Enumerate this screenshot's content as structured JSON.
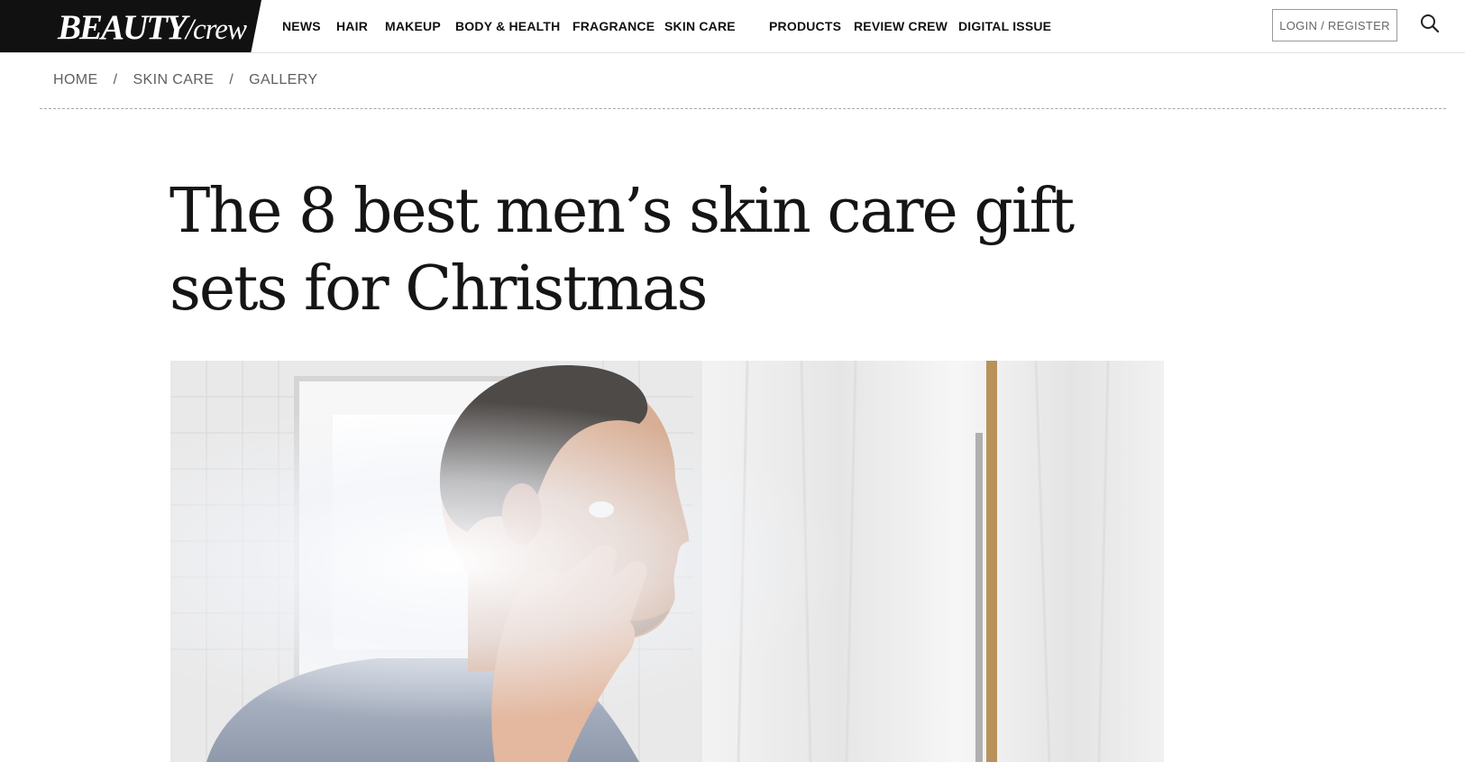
{
  "header": {
    "logo_primary": "BEAUTY",
    "logo_secondary": "/crew",
    "nav": [
      {
        "label": "NEWS"
      },
      {
        "label": "HAIR"
      },
      {
        "label": "MAKEUP"
      },
      {
        "label": "BODY & HEALTH"
      },
      {
        "label": "FRAGRANCE"
      },
      {
        "label": "SKIN CARE"
      },
      {
        "label": "PRODUCTS"
      },
      {
        "label": "REVIEW CREW"
      },
      {
        "label": "DIGITAL ISSUE"
      }
    ],
    "login_label": "LOGIN / REGISTER",
    "search_icon": "search-icon"
  },
  "breadcrumb": {
    "items": [
      "HOME",
      "SKIN CARE",
      "GALLERY"
    ],
    "separator": "/"
  },
  "article": {
    "title": "The 8 best men’s skin care gift sets for Christmas",
    "hero_image": "man-applying-face-cream-photo"
  },
  "colors": {
    "logo_bg": "#111111",
    "text": "#151515",
    "muted": "#5f5f5f",
    "border": "#9a9a9a"
  }
}
